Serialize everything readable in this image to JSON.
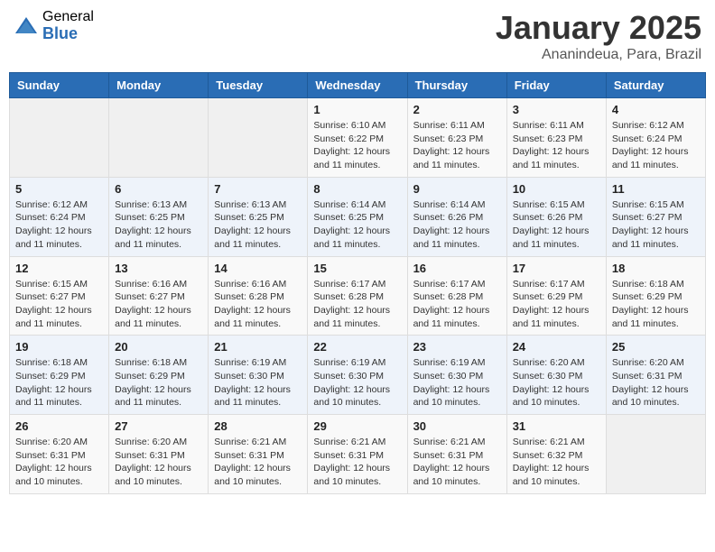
{
  "logo": {
    "general": "General",
    "blue": "Blue"
  },
  "header": {
    "title": "January 2025",
    "subtitle": "Ananindeua, Para, Brazil"
  },
  "weekdays": [
    "Sunday",
    "Monday",
    "Tuesday",
    "Wednesday",
    "Thursday",
    "Friday",
    "Saturday"
  ],
  "weeks": [
    [
      {
        "day": "",
        "info": ""
      },
      {
        "day": "",
        "info": ""
      },
      {
        "day": "",
        "info": ""
      },
      {
        "day": "1",
        "info": "Sunrise: 6:10 AM\nSunset: 6:22 PM\nDaylight: 12 hours and 11 minutes."
      },
      {
        "day": "2",
        "info": "Sunrise: 6:11 AM\nSunset: 6:23 PM\nDaylight: 12 hours and 11 minutes."
      },
      {
        "day": "3",
        "info": "Sunrise: 6:11 AM\nSunset: 6:23 PM\nDaylight: 12 hours and 11 minutes."
      },
      {
        "day": "4",
        "info": "Sunrise: 6:12 AM\nSunset: 6:24 PM\nDaylight: 12 hours and 11 minutes."
      }
    ],
    [
      {
        "day": "5",
        "info": "Sunrise: 6:12 AM\nSunset: 6:24 PM\nDaylight: 12 hours and 11 minutes."
      },
      {
        "day": "6",
        "info": "Sunrise: 6:13 AM\nSunset: 6:25 PM\nDaylight: 12 hours and 11 minutes."
      },
      {
        "day": "7",
        "info": "Sunrise: 6:13 AM\nSunset: 6:25 PM\nDaylight: 12 hours and 11 minutes."
      },
      {
        "day": "8",
        "info": "Sunrise: 6:14 AM\nSunset: 6:25 PM\nDaylight: 12 hours and 11 minutes."
      },
      {
        "day": "9",
        "info": "Sunrise: 6:14 AM\nSunset: 6:26 PM\nDaylight: 12 hours and 11 minutes."
      },
      {
        "day": "10",
        "info": "Sunrise: 6:15 AM\nSunset: 6:26 PM\nDaylight: 12 hours and 11 minutes."
      },
      {
        "day": "11",
        "info": "Sunrise: 6:15 AM\nSunset: 6:27 PM\nDaylight: 12 hours and 11 minutes."
      }
    ],
    [
      {
        "day": "12",
        "info": "Sunrise: 6:15 AM\nSunset: 6:27 PM\nDaylight: 12 hours and 11 minutes."
      },
      {
        "day": "13",
        "info": "Sunrise: 6:16 AM\nSunset: 6:27 PM\nDaylight: 12 hours and 11 minutes."
      },
      {
        "day": "14",
        "info": "Sunrise: 6:16 AM\nSunset: 6:28 PM\nDaylight: 12 hours and 11 minutes."
      },
      {
        "day": "15",
        "info": "Sunrise: 6:17 AM\nSunset: 6:28 PM\nDaylight: 12 hours and 11 minutes."
      },
      {
        "day": "16",
        "info": "Sunrise: 6:17 AM\nSunset: 6:28 PM\nDaylight: 12 hours and 11 minutes."
      },
      {
        "day": "17",
        "info": "Sunrise: 6:17 AM\nSunset: 6:29 PM\nDaylight: 12 hours and 11 minutes."
      },
      {
        "day": "18",
        "info": "Sunrise: 6:18 AM\nSunset: 6:29 PM\nDaylight: 12 hours and 11 minutes."
      }
    ],
    [
      {
        "day": "19",
        "info": "Sunrise: 6:18 AM\nSunset: 6:29 PM\nDaylight: 12 hours and 11 minutes."
      },
      {
        "day": "20",
        "info": "Sunrise: 6:18 AM\nSunset: 6:29 PM\nDaylight: 12 hours and 11 minutes."
      },
      {
        "day": "21",
        "info": "Sunrise: 6:19 AM\nSunset: 6:30 PM\nDaylight: 12 hours and 11 minutes."
      },
      {
        "day": "22",
        "info": "Sunrise: 6:19 AM\nSunset: 6:30 PM\nDaylight: 12 hours and 10 minutes."
      },
      {
        "day": "23",
        "info": "Sunrise: 6:19 AM\nSunset: 6:30 PM\nDaylight: 12 hours and 10 minutes."
      },
      {
        "day": "24",
        "info": "Sunrise: 6:20 AM\nSunset: 6:30 PM\nDaylight: 12 hours and 10 minutes."
      },
      {
        "day": "25",
        "info": "Sunrise: 6:20 AM\nSunset: 6:31 PM\nDaylight: 12 hours and 10 minutes."
      }
    ],
    [
      {
        "day": "26",
        "info": "Sunrise: 6:20 AM\nSunset: 6:31 PM\nDaylight: 12 hours and 10 minutes."
      },
      {
        "day": "27",
        "info": "Sunrise: 6:20 AM\nSunset: 6:31 PM\nDaylight: 12 hours and 10 minutes."
      },
      {
        "day": "28",
        "info": "Sunrise: 6:21 AM\nSunset: 6:31 PM\nDaylight: 12 hours and 10 minutes."
      },
      {
        "day": "29",
        "info": "Sunrise: 6:21 AM\nSunset: 6:31 PM\nDaylight: 12 hours and 10 minutes."
      },
      {
        "day": "30",
        "info": "Sunrise: 6:21 AM\nSunset: 6:31 PM\nDaylight: 12 hours and 10 minutes."
      },
      {
        "day": "31",
        "info": "Sunrise: 6:21 AM\nSunset: 6:32 PM\nDaylight: 12 hours and 10 minutes."
      },
      {
        "day": "",
        "info": ""
      }
    ]
  ]
}
